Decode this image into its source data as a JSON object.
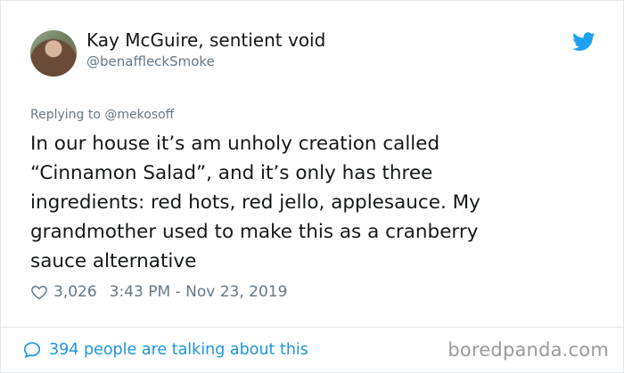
{
  "author": {
    "name": "Kay McGuire, sentient void",
    "handle": "@benaffleckSmoke"
  },
  "tweet": {
    "replying_prefix": "Replying to ",
    "replying_to": "@mekosoff",
    "text": "In our house it’s am unholy creation called\n“Cinnamon Salad”, and it’s only has three\ningredients: red hots, red jello, applesauce. My\ngrandmother used to make this as a cranberry\nsauce alternative",
    "likes": "3,026",
    "timestamp": "3:43 PM - Nov 23, 2019"
  },
  "footer": {
    "talking": "394 people are talking about this",
    "watermark": "boredpanda.com"
  },
  "icons": {
    "platform": "twitter-bird-icon",
    "like": "heart-outline-icon",
    "conversation": "speech-bubble-icon"
  },
  "colors": {
    "accent": "#1da1f2",
    "link": "#1b95e0",
    "muted": "#657786",
    "text": "#14171a"
  }
}
